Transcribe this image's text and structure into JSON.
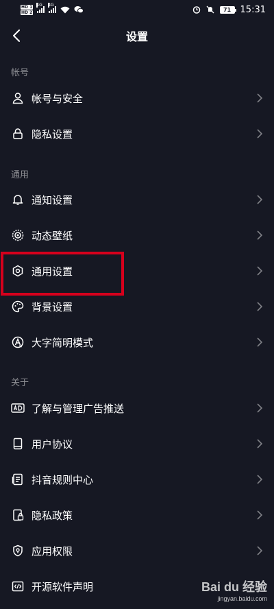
{
  "status_bar": {
    "hd1": "HD 1",
    "hd2": "HD 2",
    "net1": "4G",
    "net2": "4G",
    "battery": "71",
    "time": "15:31"
  },
  "nav": {
    "title": "设置"
  },
  "sections": [
    {
      "header": "帐号",
      "items": [
        {
          "label": "帐号与安全",
          "icon": "person-icon"
        },
        {
          "label": "隐私设置",
          "icon": "lock-icon"
        }
      ]
    },
    {
      "header": "通用",
      "items": [
        {
          "label": "通知设置",
          "icon": "bell-icon"
        },
        {
          "label": "动态壁纸",
          "icon": "live-wallpaper-icon"
        },
        {
          "label": "通用设置",
          "icon": "gear-icon"
        },
        {
          "label": "背景设置",
          "icon": "palette-icon"
        },
        {
          "label": "大字简明模式",
          "icon": "font-size-icon"
        }
      ]
    },
    {
      "header": "关于",
      "items": [
        {
          "label": "了解与管理广告推送",
          "icon": "ad-icon"
        },
        {
          "label": "用户协议",
          "icon": "book-icon"
        },
        {
          "label": "抖音规则中心",
          "icon": "rules-icon"
        },
        {
          "label": "隐私政策",
          "icon": "privacy-policy-icon"
        },
        {
          "label": "应用权限",
          "icon": "shield-icon"
        },
        {
          "label": "开源软件声明",
          "icon": "code-icon"
        }
      ]
    }
  ],
  "watermark": {
    "brand": "Bai du 经验",
    "url": "jingyan.baidu.com"
  },
  "colors": {
    "background": "#161823",
    "highlight": "#d6001c",
    "text": "#ffffff"
  }
}
